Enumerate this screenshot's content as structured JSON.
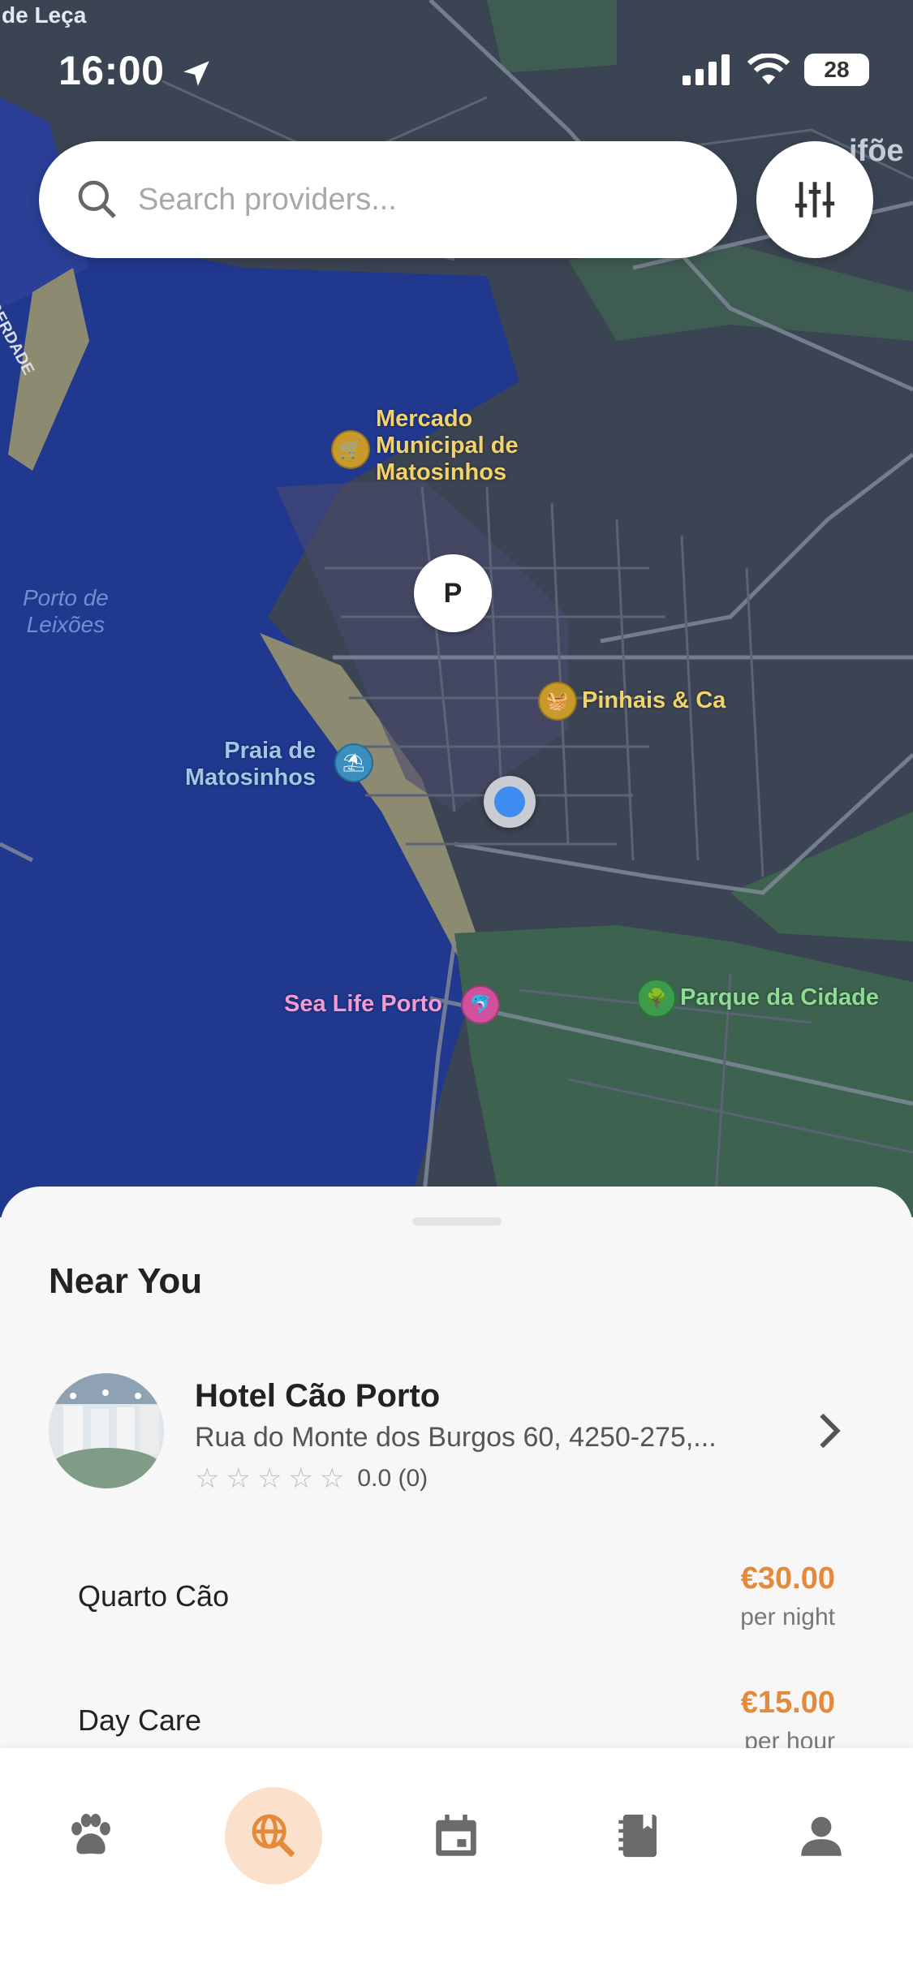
{
  "status": {
    "time": "16:00",
    "battery": "28"
  },
  "search": {
    "placeholder": "Search providers..."
  },
  "map": {
    "labels": {
      "mercado": "Mercado\nMunicipal de\nMatosinhos",
      "pinhais": "Pinhais & Ca",
      "praia": "Praia de\nMatosinhos",
      "porto_leixoes": "Porto de\nLeixões",
      "sea_life": "Sea Life Porto",
      "parque": "Parque da Cidade",
      "leca": "de Leça",
      "liberdade": "DA LIBERDADE",
      "top_right": "ifõe"
    },
    "marker_label": "P"
  },
  "sheet": {
    "title": "Near You",
    "provider": {
      "name": "Hotel Cão Porto",
      "address": "Rua do Monte dos Burgos 60, 4250-275,...",
      "rating_value": "0.0 (0)",
      "stars": 0
    },
    "services": [
      {
        "name": "Quarto Cão",
        "price": "€30.00",
        "unit": "per night"
      },
      {
        "name": "Day Care",
        "price": "€15.00",
        "unit": "per hour"
      }
    ]
  },
  "tabs": [
    {
      "icon": "paw-icon",
      "active": false
    },
    {
      "icon": "search-globe-icon",
      "active": true
    },
    {
      "icon": "calendar-icon",
      "active": false
    },
    {
      "icon": "notebook-icon",
      "active": false
    },
    {
      "icon": "profile-icon",
      "active": false
    }
  ],
  "colors": {
    "accent": "#e48a3a",
    "active_tab_bg": "#fbe0cb",
    "map_bg": "#3b4453",
    "water": "#21388f"
  }
}
